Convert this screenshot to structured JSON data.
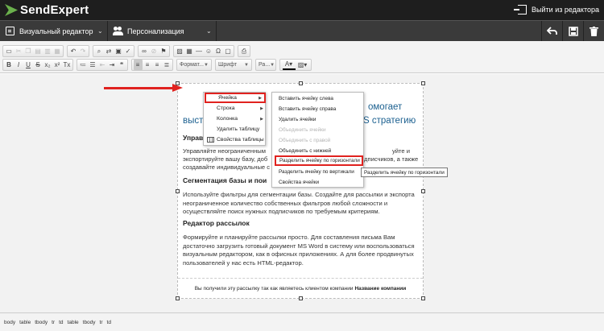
{
  "app": {
    "logo": "SendExpert"
  },
  "header": {
    "exit_label": "Выйти из редактора"
  },
  "nav": {
    "visual_editor": "Визуальный редактор",
    "personalization": "Персонализация"
  },
  "toolbar": {
    "format": "Формат...",
    "font": "Шрифт",
    "size": "Ра..."
  },
  "document": {
    "title_line1_right": "омогает",
    "title_line2_left": "выст",
    "title_line2_right": "S стратегию",
    "section1_heading": "Управл",
    "section1_lines": [
      "Управляйте неограниченным",
      "экспортируйте вашу базу, доб",
      "создавайте индивидуальные с"
    ],
    "section1_right": [
      "уйте и",
      "одписчиков, а также"
    ],
    "section2_heading": "Сегментация базы и пои",
    "section2_text": "Используйте фильтры для сегментации базы. Создайте для рассылки и экспорта неограниченное количество собственных фильтров любой сложности и осуществляйте поиск нужных подписчиков по требуемым критериям.",
    "section3_heading": "Редактор рассылок",
    "section3_text": "Формируйте и планируйте рассылки просто. Для составления письма Вам достаточно загрузить готовый документ MS Word в систему или воспользоваться визуальным редактором, как в офисных приложениях. А для более продвинутых пользователей у нас есть HTML-редактор.",
    "footer_text": "Вы получили эту рассылку так как являетесь клиентом компании",
    "footer_company": "Название компании"
  },
  "context_menu": {
    "items": [
      {
        "label": "Ячейка",
        "submenu": true
      },
      {
        "label": "Строка",
        "submenu": true
      },
      {
        "label": "Колонка",
        "submenu": true
      },
      {
        "label": "Удалить таблицу"
      },
      {
        "label": "Свойства таблицы"
      }
    ]
  },
  "cell_submenu": {
    "items": [
      {
        "label": "Вставить ячейку слева",
        "disabled": false
      },
      {
        "label": "Вставить ячейку справа",
        "disabled": false
      },
      {
        "label": "Удалить ячейки",
        "disabled": false
      },
      {
        "label": "Объединить ячейки",
        "disabled": true
      },
      {
        "label": "Объединить с правой",
        "disabled": true
      },
      {
        "label": "Объединить с нижней",
        "disabled": false
      },
      {
        "label": "Разделить ячейку по горизонтали",
        "disabled": false
      },
      {
        "label": "Разделить ячейку по вертикали",
        "disabled": false
      },
      {
        "label": "Свойства ячейки",
        "disabled": false
      }
    ]
  },
  "tooltip": "Разделить ячейку по горизонтали",
  "status_path": [
    "body",
    "table",
    "tbody",
    "tr",
    "td",
    "table",
    "tbody",
    "tr",
    "td"
  ],
  "colors": {
    "accent": "#e0221f",
    "title": "#1a5f8f",
    "topbar": "#1e1e1e",
    "navbar": "#3a3a3a"
  }
}
